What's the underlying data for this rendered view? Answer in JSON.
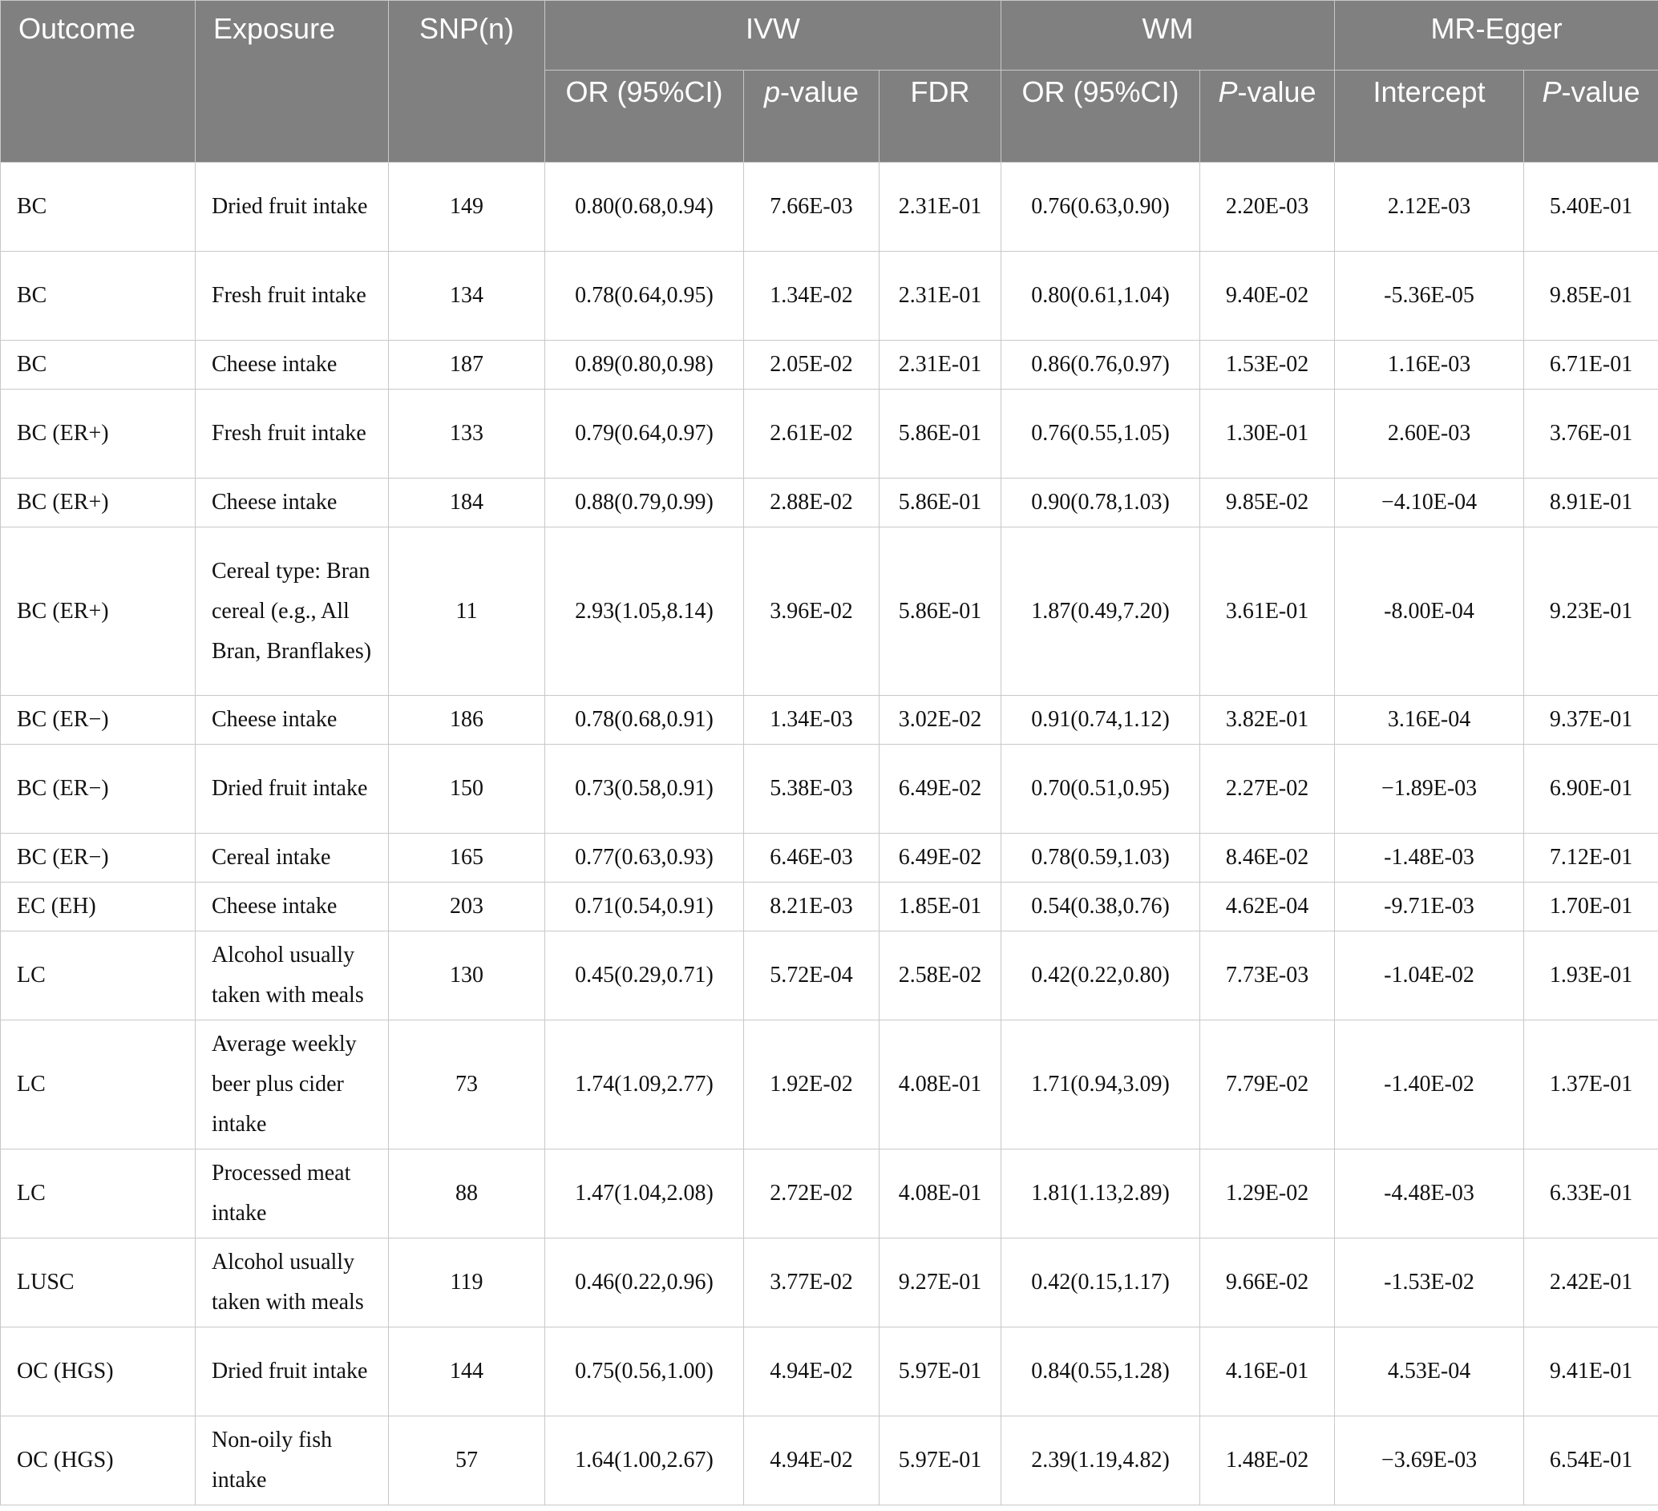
{
  "table": {
    "headers": {
      "outcome": "Outcome",
      "exposure": "Exposure",
      "snp": "SNP(n)",
      "ivw": "IVW",
      "wm": "WM",
      "mr_egger": "MR-Egger",
      "ivw_or": "OR (95%CI)",
      "ivw_p_italic": "p",
      "ivw_p_rest": "-value",
      "ivw_fdr": "FDR",
      "wm_or": "OR (95%CI)",
      "wm_p_italic": "P",
      "wm_p_rest": "-value",
      "egger_intercept": "Intercept",
      "egger_p_italic": "P",
      "egger_p_rest": "-value"
    },
    "rows": [
      {
        "outcome": "BC",
        "exposure": "Dried fruit intake",
        "snp": "149",
        "ivw_or": "0.80(0.68,0.94)",
        "ivw_p": "7.66E-03",
        "ivw_fdr": "2.31E-01",
        "wm_or": "0.76(0.63,0.90)",
        "wm_p": "2.20E-03",
        "egger_intercept": "2.12E-03",
        "egger_p": "5.40E-01"
      },
      {
        "outcome": "BC",
        "exposure": "Fresh fruit intake",
        "snp": "134",
        "ivw_or": "0.78(0.64,0.95)",
        "ivw_p": "1.34E-02",
        "ivw_fdr": "2.31E-01",
        "wm_or": "0.80(0.61,1.04)",
        "wm_p": "9.40E-02",
        "egger_intercept": "-5.36E-05",
        "egger_p": "9.85E-01"
      },
      {
        "outcome": "BC",
        "exposure": "Cheese intake",
        "snp": "187",
        "ivw_or": "0.89(0.80,0.98)",
        "ivw_p": "2.05E-02",
        "ivw_fdr": "2.31E-01",
        "wm_or": "0.86(0.76,0.97)",
        "wm_p": "1.53E-02",
        "egger_intercept": "1.16E-03",
        "egger_p": "6.71E-01"
      },
      {
        "outcome": "BC (ER+)",
        "exposure": "Fresh fruit intake",
        "snp": "133",
        "ivw_or": "0.79(0.64,0.97)",
        "ivw_p": "2.61E-02",
        "ivw_fdr": "5.86E-01",
        "wm_or": "0.76(0.55,1.05)",
        "wm_p": "1.30E-01",
        "egger_intercept": "2.60E-03",
        "egger_p": "3.76E-01"
      },
      {
        "outcome": "BC (ER+)",
        "exposure": "Cheese intake",
        "snp": "184",
        "ivw_or": "0.88(0.79,0.99)",
        "ivw_p": "2.88E-02",
        "ivw_fdr": "5.86E-01",
        "wm_or": "0.90(0.78,1.03)",
        "wm_p": "9.85E-02",
        "egger_intercept": "−4.10E-04",
        "egger_p": "8.91E-01"
      },
      {
        "outcome": "BC (ER+)",
        "exposure": "Cereal type: Bran cereal (e.g., All Bran, Branflakes)",
        "snp": "11",
        "ivw_or": "2.93(1.05,8.14)",
        "ivw_p": "3.96E-02",
        "ivw_fdr": "5.86E-01",
        "wm_or": "1.87(0.49,7.20)",
        "wm_p": "3.61E-01",
        "egger_intercept": "-8.00E-04",
        "egger_p": "9.23E-01"
      },
      {
        "outcome": "BC (ER−)",
        "exposure": "Cheese intake",
        "snp": "186",
        "ivw_or": "0.78(0.68,0.91)",
        "ivw_p": "1.34E-03",
        "ivw_fdr": "3.02E-02",
        "wm_or": "0.91(0.74,1.12)",
        "wm_p": "3.82E-01",
        "egger_intercept": "3.16E-04",
        "egger_p": "9.37E-01"
      },
      {
        "outcome": "BC (ER−)",
        "exposure": "Dried fruit intake",
        "snp": "150",
        "ivw_or": "0.73(0.58,0.91)",
        "ivw_p": "5.38E-03",
        "ivw_fdr": "6.49E-02",
        "wm_or": "0.70(0.51,0.95)",
        "wm_p": "2.27E-02",
        "egger_intercept": "−1.89E-03",
        "egger_p": "6.90E-01"
      },
      {
        "outcome": "BC (ER−)",
        "exposure": "Cereal intake",
        "snp": "165",
        "ivw_or": "0.77(0.63,0.93)",
        "ivw_p": "6.46E-03",
        "ivw_fdr": "6.49E-02",
        "wm_or": "0.78(0.59,1.03)",
        "wm_p": "8.46E-02",
        "egger_intercept": "-1.48E-03",
        "egger_p": "7.12E-01"
      },
      {
        "outcome": "EC (EH)",
        "exposure": "Cheese intake",
        "snp": "203",
        "ivw_or": "0.71(0.54,0.91)",
        "ivw_p": "8.21E-03",
        "ivw_fdr": "1.85E-01",
        "wm_or": "0.54(0.38,0.76)",
        "wm_p": "4.62E-04",
        "egger_intercept": "-9.71E-03",
        "egger_p": "1.70E-01"
      },
      {
        "outcome": "LC",
        "exposure": "Alcohol usually taken with meals",
        "snp": "130",
        "ivw_or": "0.45(0.29,0.71)",
        "ivw_p": "5.72E-04",
        "ivw_fdr": "2.58E-02",
        "wm_or": "0.42(0.22,0.80)",
        "wm_p": "7.73E-03",
        "egger_intercept": "-1.04E-02",
        "egger_p": "1.93E-01"
      },
      {
        "outcome": "LC",
        "exposure": "Average weekly beer plus cider intake",
        "snp": "73",
        "ivw_or": "1.74(1.09,2.77)",
        "ivw_p": "1.92E-02",
        "ivw_fdr": "4.08E-01",
        "wm_or": "1.71(0.94,3.09)",
        "wm_p": "7.79E-02",
        "egger_intercept": "-1.40E-02",
        "egger_p": "1.37E-01"
      },
      {
        "outcome": "LC",
        "exposure": "Processed meat intake",
        "snp": "88",
        "ivw_or": "1.47(1.04,2.08)",
        "ivw_p": "2.72E-02",
        "ivw_fdr": "4.08E-01",
        "wm_or": "1.81(1.13,2.89)",
        "wm_p": "1.29E-02",
        "egger_intercept": "-4.48E-03",
        "egger_p": "6.33E-01"
      },
      {
        "outcome": "LUSC",
        "exposure": "Alcohol usually taken with meals",
        "snp": "119",
        "ivw_or": "0.46(0.22,0.96)",
        "ivw_p": "3.77E-02",
        "ivw_fdr": "9.27E-01",
        "wm_or": "0.42(0.15,1.17)",
        "wm_p": "9.66E-02",
        "egger_intercept": "-1.53E-02",
        "egger_p": "2.42E-01"
      },
      {
        "outcome": "OC (HGS)",
        "exposure": "Dried fruit intake",
        "snp": "144",
        "ivw_or": "0.75(0.56,1.00)",
        "ivw_p": "4.94E-02",
        "ivw_fdr": "5.97E-01",
        "wm_or": "0.84(0.55,1.28)",
        "wm_p": "4.16E-01",
        "egger_intercept": "4.53E-04",
        "egger_p": "9.41E-01"
      },
      {
        "outcome": "OC (HGS)",
        "exposure": "Non-oily fish intake",
        "snp": "57",
        "ivw_or": "1.64(1.00,2.67)",
        "ivw_p": "4.94E-02",
        "ivw_fdr": "5.97E-01",
        "wm_or": "2.39(1.19,4.82)",
        "wm_p": "1.48E-02",
        "egger_intercept": "−3.69E-03",
        "egger_p": "6.54E-01"
      }
    ]
  }
}
